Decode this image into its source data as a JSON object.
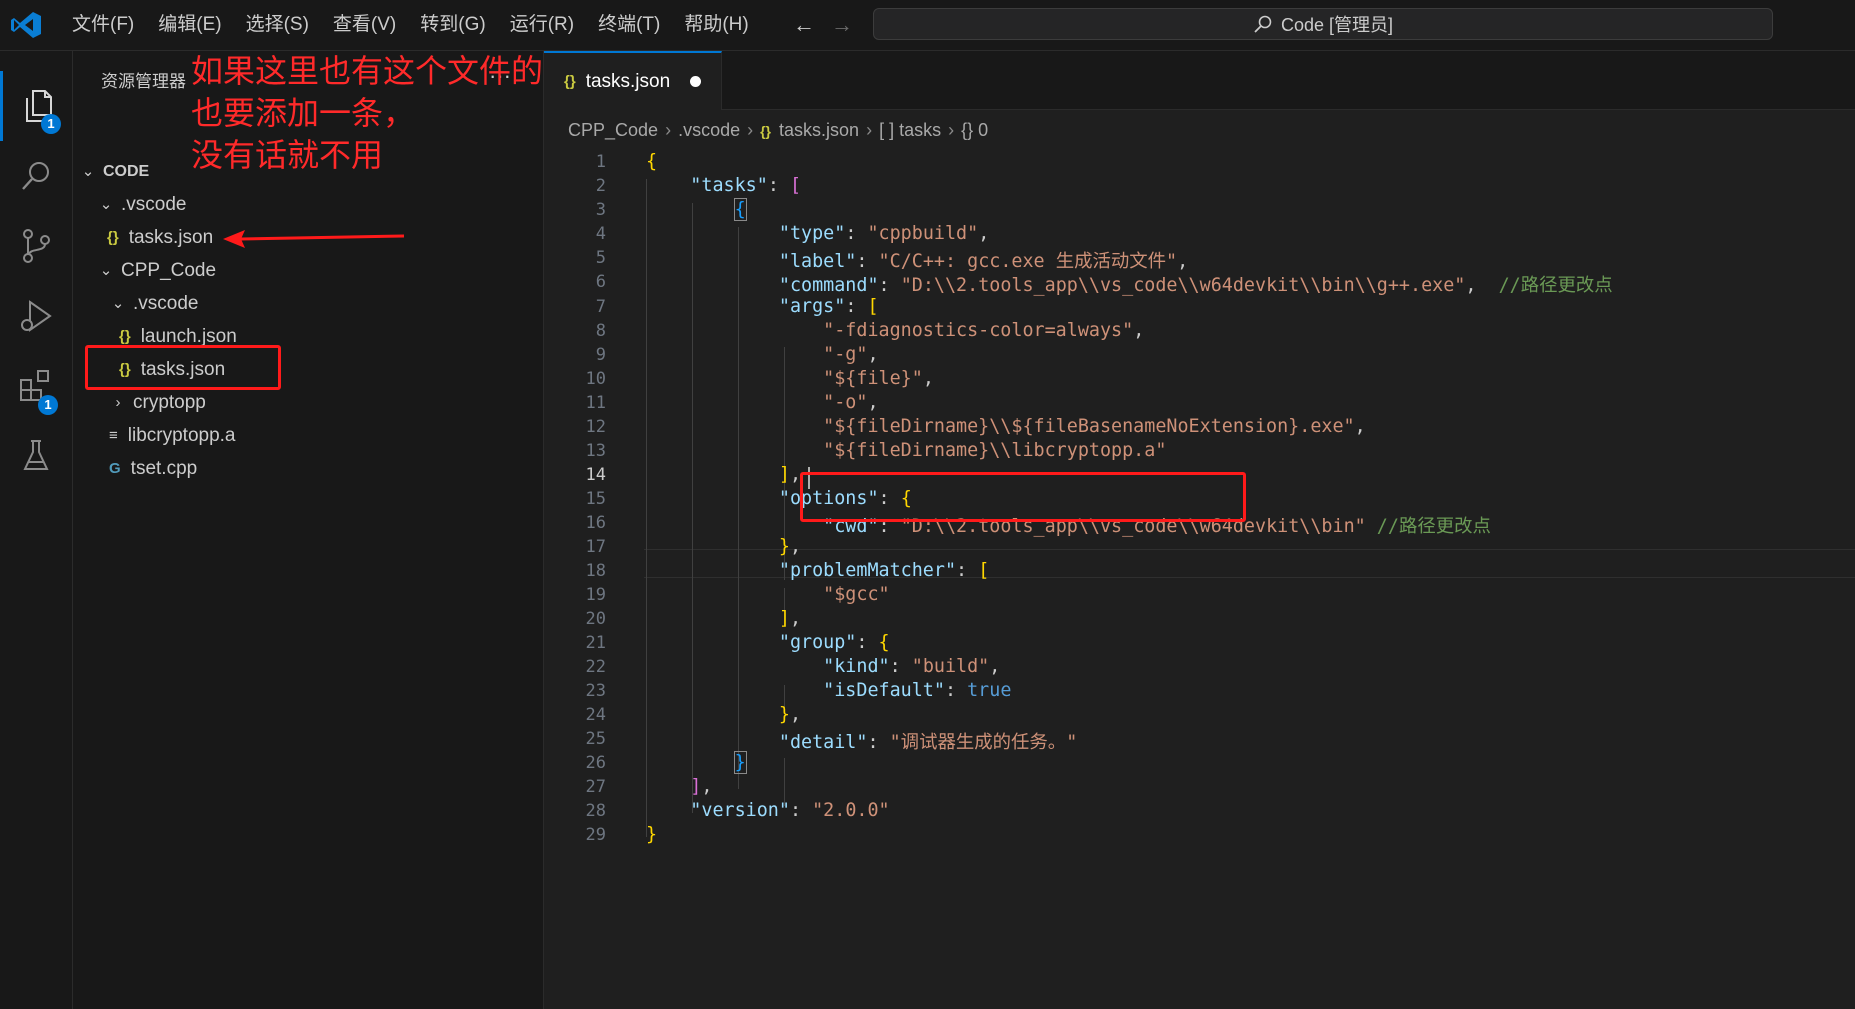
{
  "menu": [
    "文件(F)",
    "编辑(E)",
    "选择(S)",
    "查看(V)",
    "转到(G)",
    "运行(R)",
    "终端(T)",
    "帮助(H)"
  ],
  "nav": {
    "back": "←",
    "forward": "→"
  },
  "command_center": {
    "label": "Code [管理员]"
  },
  "activity_bar": {
    "explorer_badge": "1",
    "extensions_badge": "1"
  },
  "sidebar": {
    "title": "资源管理器",
    "more": "···",
    "root_label": "CODE",
    "tree": [
      {
        "label": ".vscode",
        "kind": "folder"
      },
      {
        "label": "tasks.json",
        "kind": "json"
      },
      {
        "label": "CPP_Code",
        "kind": "folder"
      },
      {
        "label": ".vscode",
        "kind": "folder"
      },
      {
        "label": "launch.json",
        "kind": "json"
      },
      {
        "label": "tasks.json",
        "kind": "json"
      },
      {
        "label": "cryptopp",
        "kind": "folder-collapsed"
      },
      {
        "label": "libcryptopp.a",
        "kind": "file"
      },
      {
        "label": "tset.cpp",
        "kind": "cpp"
      }
    ]
  },
  "annotation": {
    "lines": [
      "如果这里也有这个文件的，",
      "也要添加一条，",
      "没有话就不用"
    ],
    "color": "#ff1a1a"
  },
  "tab": {
    "label": "tasks.json",
    "icon": "{}"
  },
  "breadcrumbs": {
    "items": [
      "CPP_Code",
      ".vscode",
      "tasks.json",
      "[ ] tasks",
      "{} 0"
    ],
    "json_icon": "{}"
  },
  "editor": {
    "active_line": 14,
    "line_numbers": [
      "1",
      "2",
      "3",
      "4",
      "5",
      "6",
      "7",
      "8",
      "9",
      "10",
      "11",
      "12",
      "13",
      "14",
      "15",
      "16",
      "17",
      "18",
      "19",
      "20",
      "21",
      "22",
      "23",
      "24",
      "25",
      "26",
      "27",
      "28",
      "29"
    ]
  },
  "colors": {
    "accent": "#0078d4",
    "json_icon": "#cbcb41",
    "annotation": "#ff1a1a"
  }
}
